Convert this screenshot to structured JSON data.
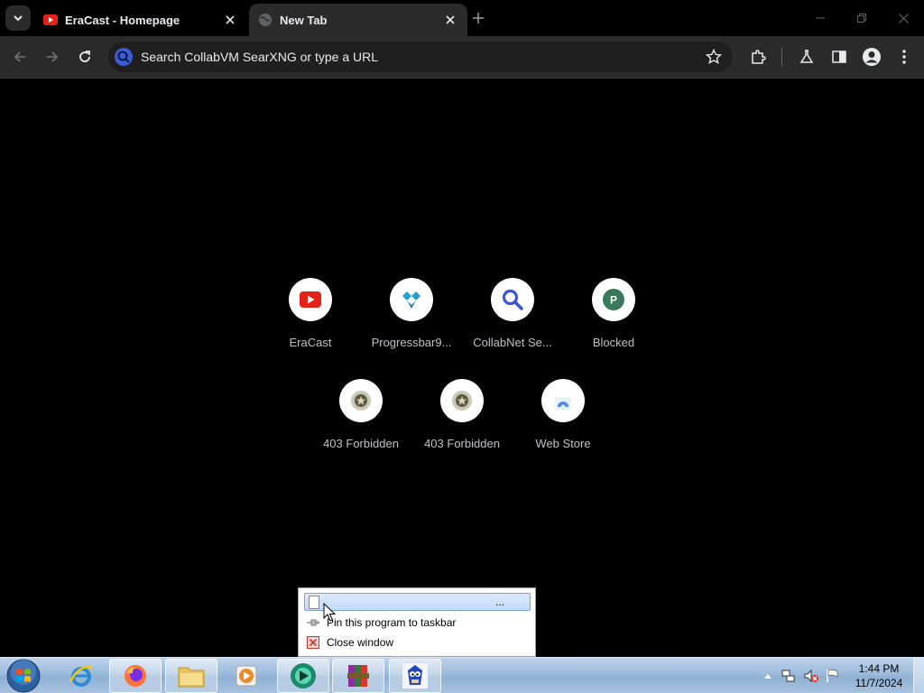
{
  "browser": {
    "tabs": [
      {
        "title": "EraCast - Homepage",
        "active": false,
        "favicon": "youtube-icon"
      },
      {
        "title": "New Tab",
        "active": true,
        "favicon": "globe-icon"
      }
    ],
    "omnibox": {
      "placeholder": "Search CollabVM SearXNG or type a URL",
      "value": ""
    },
    "accent": "#2b2b2b"
  },
  "ntp": {
    "shortcuts_row1": [
      {
        "label": "EraCast",
        "icon": "youtube-icon"
      },
      {
        "label": "Progressbar9...",
        "icon": "progressbar-icon"
      },
      {
        "label": "CollabNet Se...",
        "icon": "magnifier-icon"
      },
      {
        "label": "Blocked",
        "icon": "p-letter-icon"
      }
    ],
    "shortcuts_row2": [
      {
        "label": "403 Forbidden",
        "icon": "badge-icon"
      },
      {
        "label": "403 Forbidden",
        "icon": "badge-icon"
      },
      {
        "label": "Web Store",
        "icon": "webstore-icon"
      }
    ]
  },
  "jumplist": {
    "header_dots": "...",
    "items": [
      {
        "label": "Pin this program to taskbar",
        "icon": "pin-icon"
      },
      {
        "label": "Close window",
        "icon": "close-window-icon"
      }
    ]
  },
  "taskbar": {
    "apps": [
      "internet-explorer-icon",
      "firefox-icon",
      "file-explorer-icon",
      "media-player-icon",
      "chrome-app-icon",
      "winrar-icon",
      "sonic-app-icon"
    ],
    "clock": {
      "time": "1:44 PM",
      "date": "11/7/2024"
    }
  }
}
